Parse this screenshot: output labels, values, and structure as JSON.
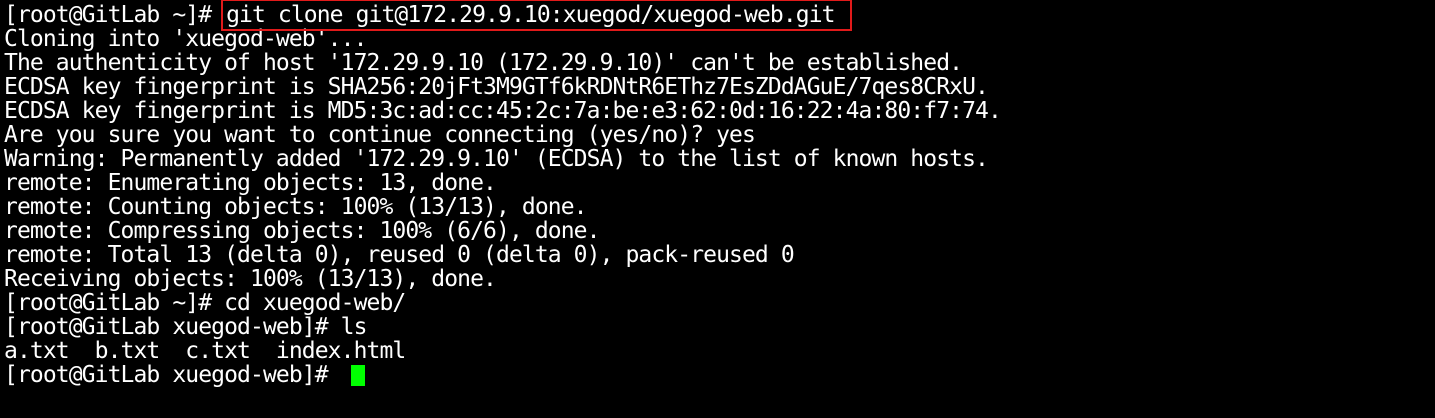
{
  "terminal": {
    "first_prompt": "[root@GitLab ~]# ",
    "first_command": "git clone git@172.29.9.10:xuegod/xuegod-web.git",
    "output_lines": [
      "Cloning into 'xuegod-web'...",
      "The authenticity of host '172.29.9.10 (172.29.9.10)' can't be established.",
      "ECDSA key fingerprint is SHA256:20jFt3M9GTf6kRDNtR6EThz7EsZDdAGuE/7qes8CRxU.",
      "ECDSA key fingerprint is MD5:3c:ad:cc:45:2c:7a:be:e3:62:0d:16:22:4a:80:f7:74.",
      "Are you sure you want to continue connecting (yes/no)? yes",
      "Warning: Permanently added '172.29.9.10' (ECDSA) to the list of known hosts.",
      "remote: Enumerating objects: 13, done.",
      "remote: Counting objects: 100% (13/13), done.",
      "remote: Compressing objects: 100% (6/6), done.",
      "remote: Total 13 (delta 0), reused 0 (delta 0), pack-reused 0",
      "Receiving objects: 100% (13/13), done.",
      "[root@GitLab ~]# cd xuegod-web/",
      "[root@GitLab xuegod-web]# ls",
      "a.txt  b.txt  c.txt  index.html"
    ],
    "last_prompt": "[root@GitLab xuegod-web]# ",
    "colors": {
      "background": "#000000",
      "foreground": "#ffffff",
      "highlight_box": "#e11a1a",
      "cursor": "#00ff00"
    }
  }
}
